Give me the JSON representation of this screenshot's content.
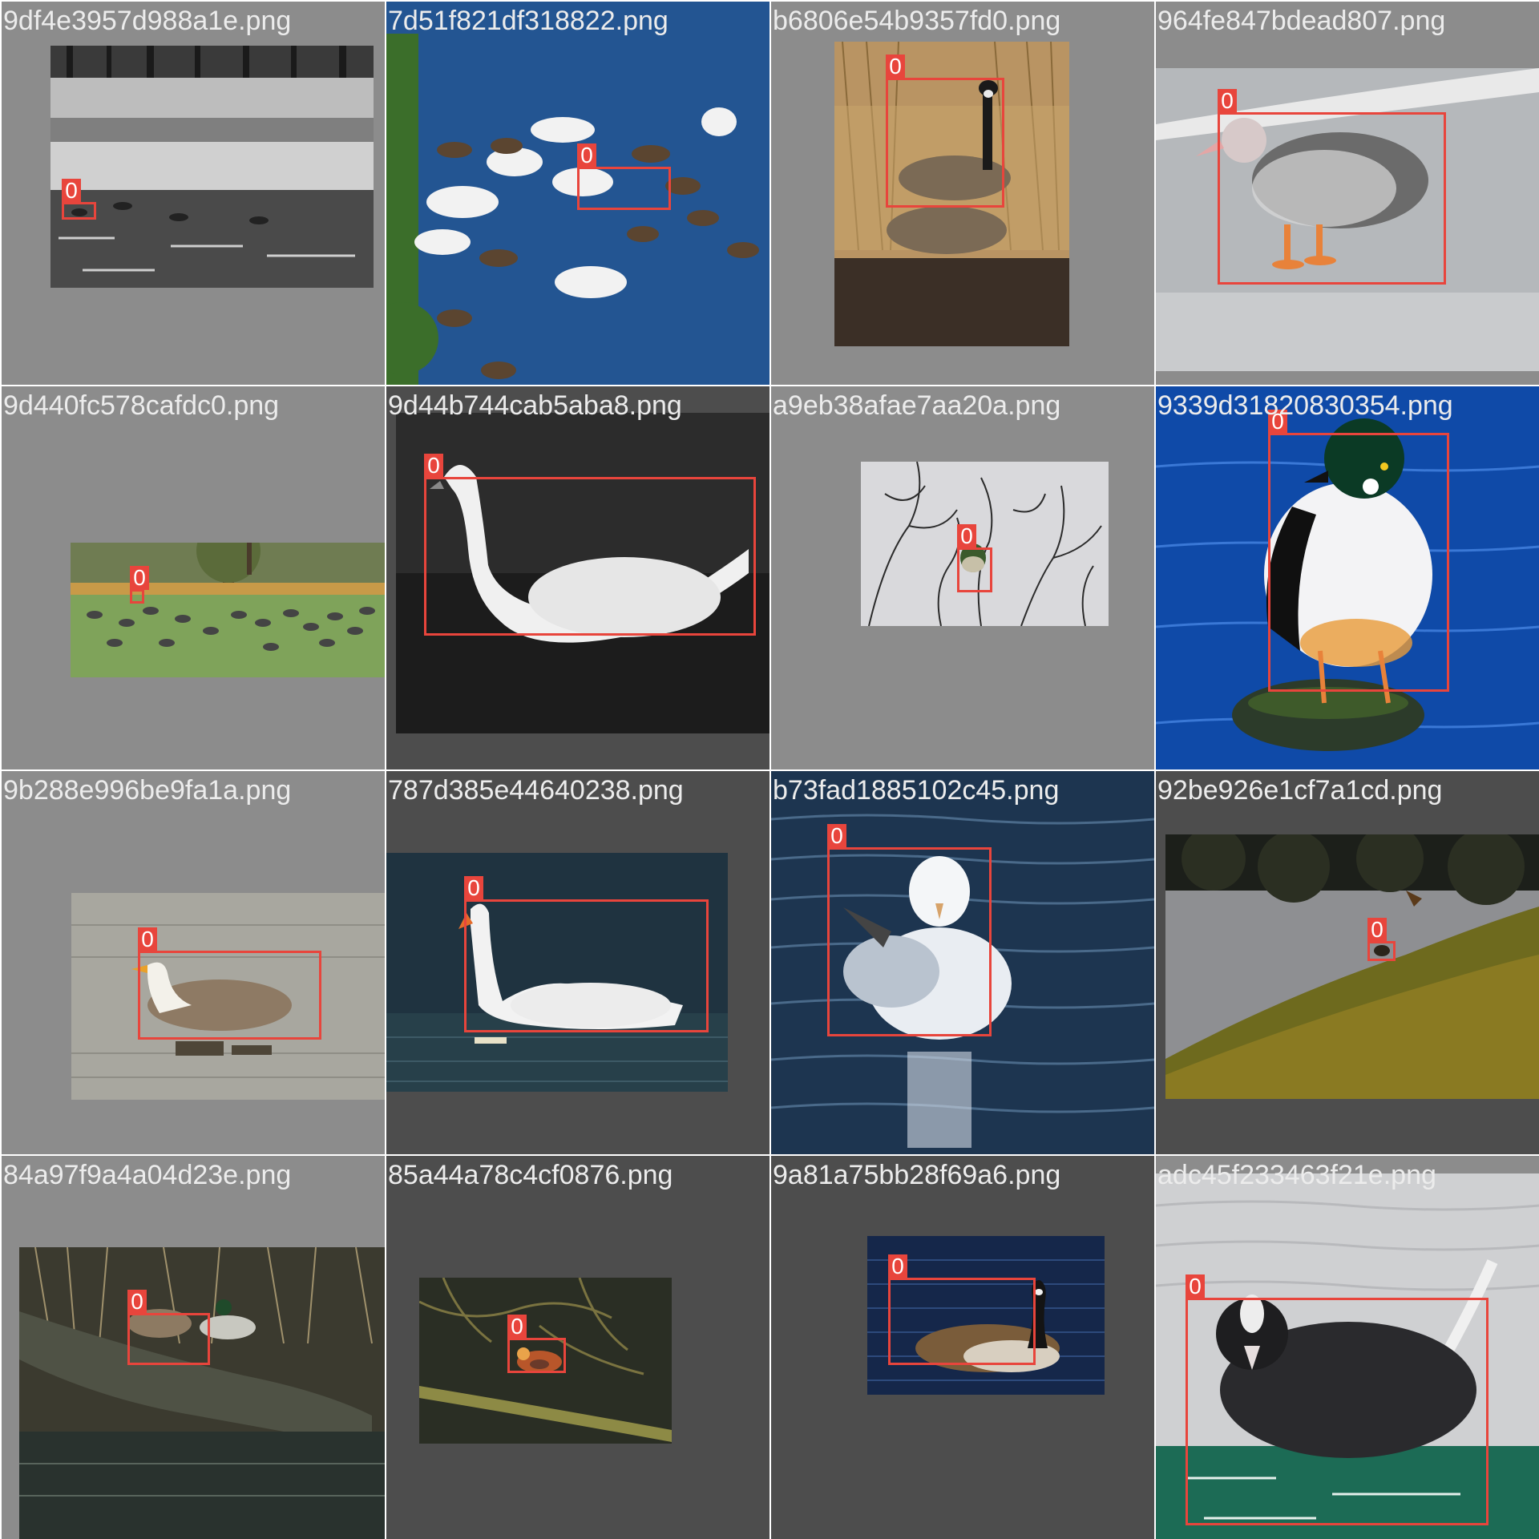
{
  "grid": {
    "title": "",
    "tiles": [
      {
        "filename": "9df4e3957d988a1e.png",
        "scene": "Black-and-white misty pond with geese swimming in a line",
        "class_label": "0"
      },
      {
        "filename": "7d51f821df318822.png",
        "scene": "Swans and geese crowding on blue water",
        "class_label": "0"
      },
      {
        "filename": "b6806e54b9357fd0.png",
        "scene": "Canada geese standing in reeds by the water",
        "class_label": "0"
      },
      {
        "filename": "964fe847bdead807.png",
        "scene": "Speckled duck standing on pavement",
        "class_label": "0"
      },
      {
        "filename": "9d440fc578cafdc0.png",
        "scene": "Flock of geese on a grassy park lawn",
        "class_label": "0"
      },
      {
        "filename": "9d44b744cab5aba8.png",
        "scene": "White swan on dark water",
        "class_label": "0"
      },
      {
        "filename": "a9eb38afae7aa20a.png",
        "scene": "Small duck among reflected branches",
        "class_label": "0"
      },
      {
        "filename": "9339d31820830354.png",
        "scene": "Goldeneye duck standing on a mossy rock in blue water",
        "class_label": "0"
      },
      {
        "filename": "9b288e996be9fa1a.png",
        "scene": "Bar-headed goose swimming",
        "class_label": "0"
      },
      {
        "filename": "787d385e44640238.png",
        "scene": "Mute swan swimming on dark water",
        "class_label": "0"
      },
      {
        "filename": "b73fad1885102c45.png",
        "scene": "Gull floating on rippled water",
        "class_label": "0"
      },
      {
        "filename": "92be926e1cf7a1cd.png",
        "scene": "Small bird on a grassy bank by the water",
        "class_label": "0"
      },
      {
        "filename": "84a97f9a4a04d23e.png",
        "scene": "Mallards resting on a fallen log",
        "class_label": "0"
      },
      {
        "filename": "85a44a78c4cf0876.png",
        "scene": "Mandarin duck among branches on the water",
        "class_label": "0"
      },
      {
        "filename": "9a81a75bb28f69a6.png",
        "scene": "Canada goose swimming on dark blue water",
        "class_label": "0"
      },
      {
        "filename": "adc45f233463f21e.png",
        "scene": "Coot floating on green-tinted water",
        "class_label": "0"
      }
    ]
  },
  "colors": {
    "box": "#e8453c",
    "tile_light": "#8c8c8c",
    "tile_dark": "#4d4d4d",
    "filename_text": "#ececec"
  }
}
